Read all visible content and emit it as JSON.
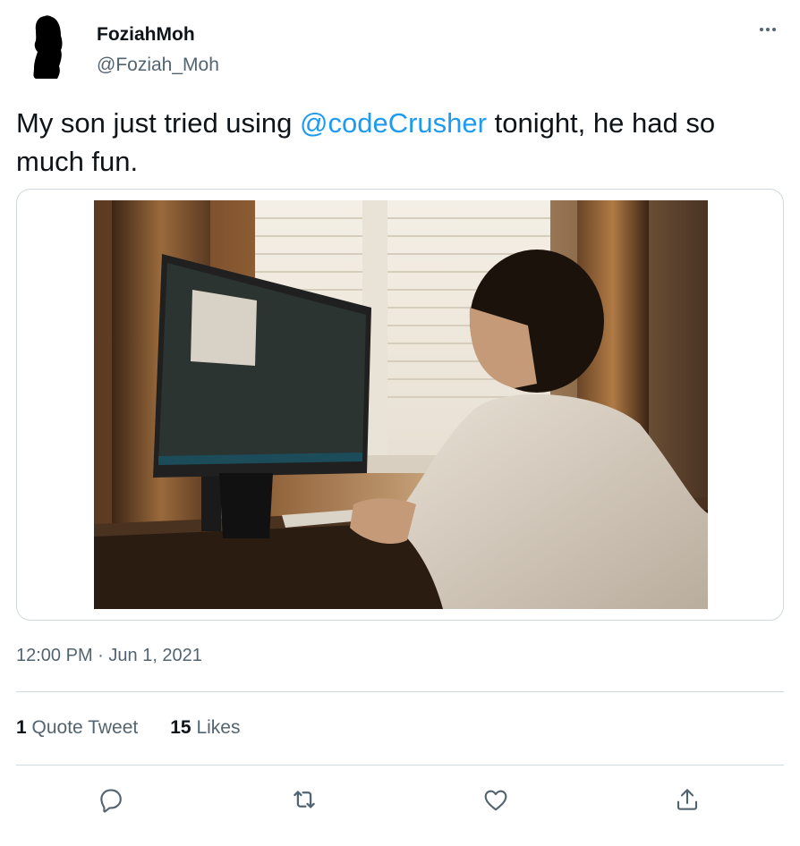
{
  "author": {
    "display_name": "FoziahMoh",
    "handle": "@Foziah_Moh",
    "avatar_icon": "silhouette-avatar"
  },
  "more_icon": "more-horizontal-icon",
  "tweet": {
    "text_before": "My son just tried using ",
    "mention": "@codeCrusher",
    "text_after": " tonight, he had so much fun."
  },
  "media": {
    "alt": "Boy coding on a desktop computer"
  },
  "meta": {
    "time": "12:00 PM",
    "separator": " · ",
    "date": "Jun 1, 2021"
  },
  "stats": {
    "quote_count": "1",
    "quote_label": "Quote Tweet",
    "likes_count": "15",
    "likes_label": "Likes"
  },
  "actions": {
    "reply_icon": "reply-icon",
    "retweet_icon": "retweet-icon",
    "like_icon": "like-icon",
    "share_icon": "share-icon"
  },
  "colors": {
    "link": "#1d9bf0",
    "secondary_text": "#536471",
    "border": "#cfd9de"
  }
}
